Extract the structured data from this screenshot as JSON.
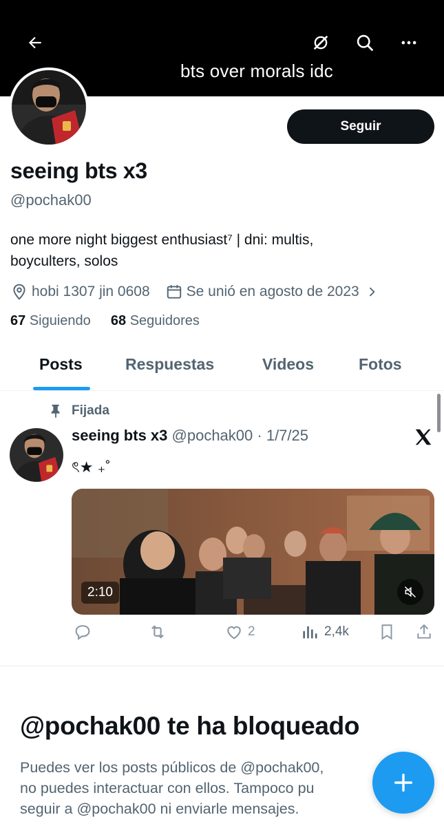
{
  "header": {
    "title": "bts over morals idc",
    "icons": [
      "back-arrow-icon",
      "no-connection-icon",
      "search-icon",
      "more-icon"
    ]
  },
  "profile": {
    "follow_label": "Seguir",
    "display_name": "seeing bts x3",
    "handle": "@pochak00",
    "bio_line1": "one more night biggest enthusiast⁷ | dni: multis,",
    "bio_line2": "boyculters, solos",
    "location": "hobi 1307 jin 0608",
    "joined": "Se unió en agosto de 2023",
    "following_count": "67",
    "following_label": "Siguiendo",
    "followers_count": "68",
    "followers_label": "Seguidores"
  },
  "tabs": [
    {
      "label": "Posts",
      "active": true
    },
    {
      "label": "Respuestas",
      "active": false
    },
    {
      "label": "Videos",
      "active": false
    },
    {
      "label": "Fotos",
      "active": false
    }
  ],
  "pinned_post": {
    "pinned_label": "Fijada",
    "author_name": "seeing bts x3",
    "author_handle": "@pochak00",
    "date": "· 1/7/25",
    "text": "ৎ★ ₊˚",
    "video_duration": "2:10",
    "likes": "2",
    "views": "2,4k"
  },
  "blocked": {
    "title": "@pochak00 te ha bloqueado",
    "line1": "Puedes ver los posts públicos de @pochak00,",
    "line2": "no puedes interactuar con ellos. Tampoco pu",
    "line3": "seguir a @pochak00 ni enviarle mensajes."
  },
  "colors": {
    "accent": "#1d9bf0",
    "banner": "#000000",
    "text_primary": "#0f1419",
    "text_secondary": "#536471"
  }
}
